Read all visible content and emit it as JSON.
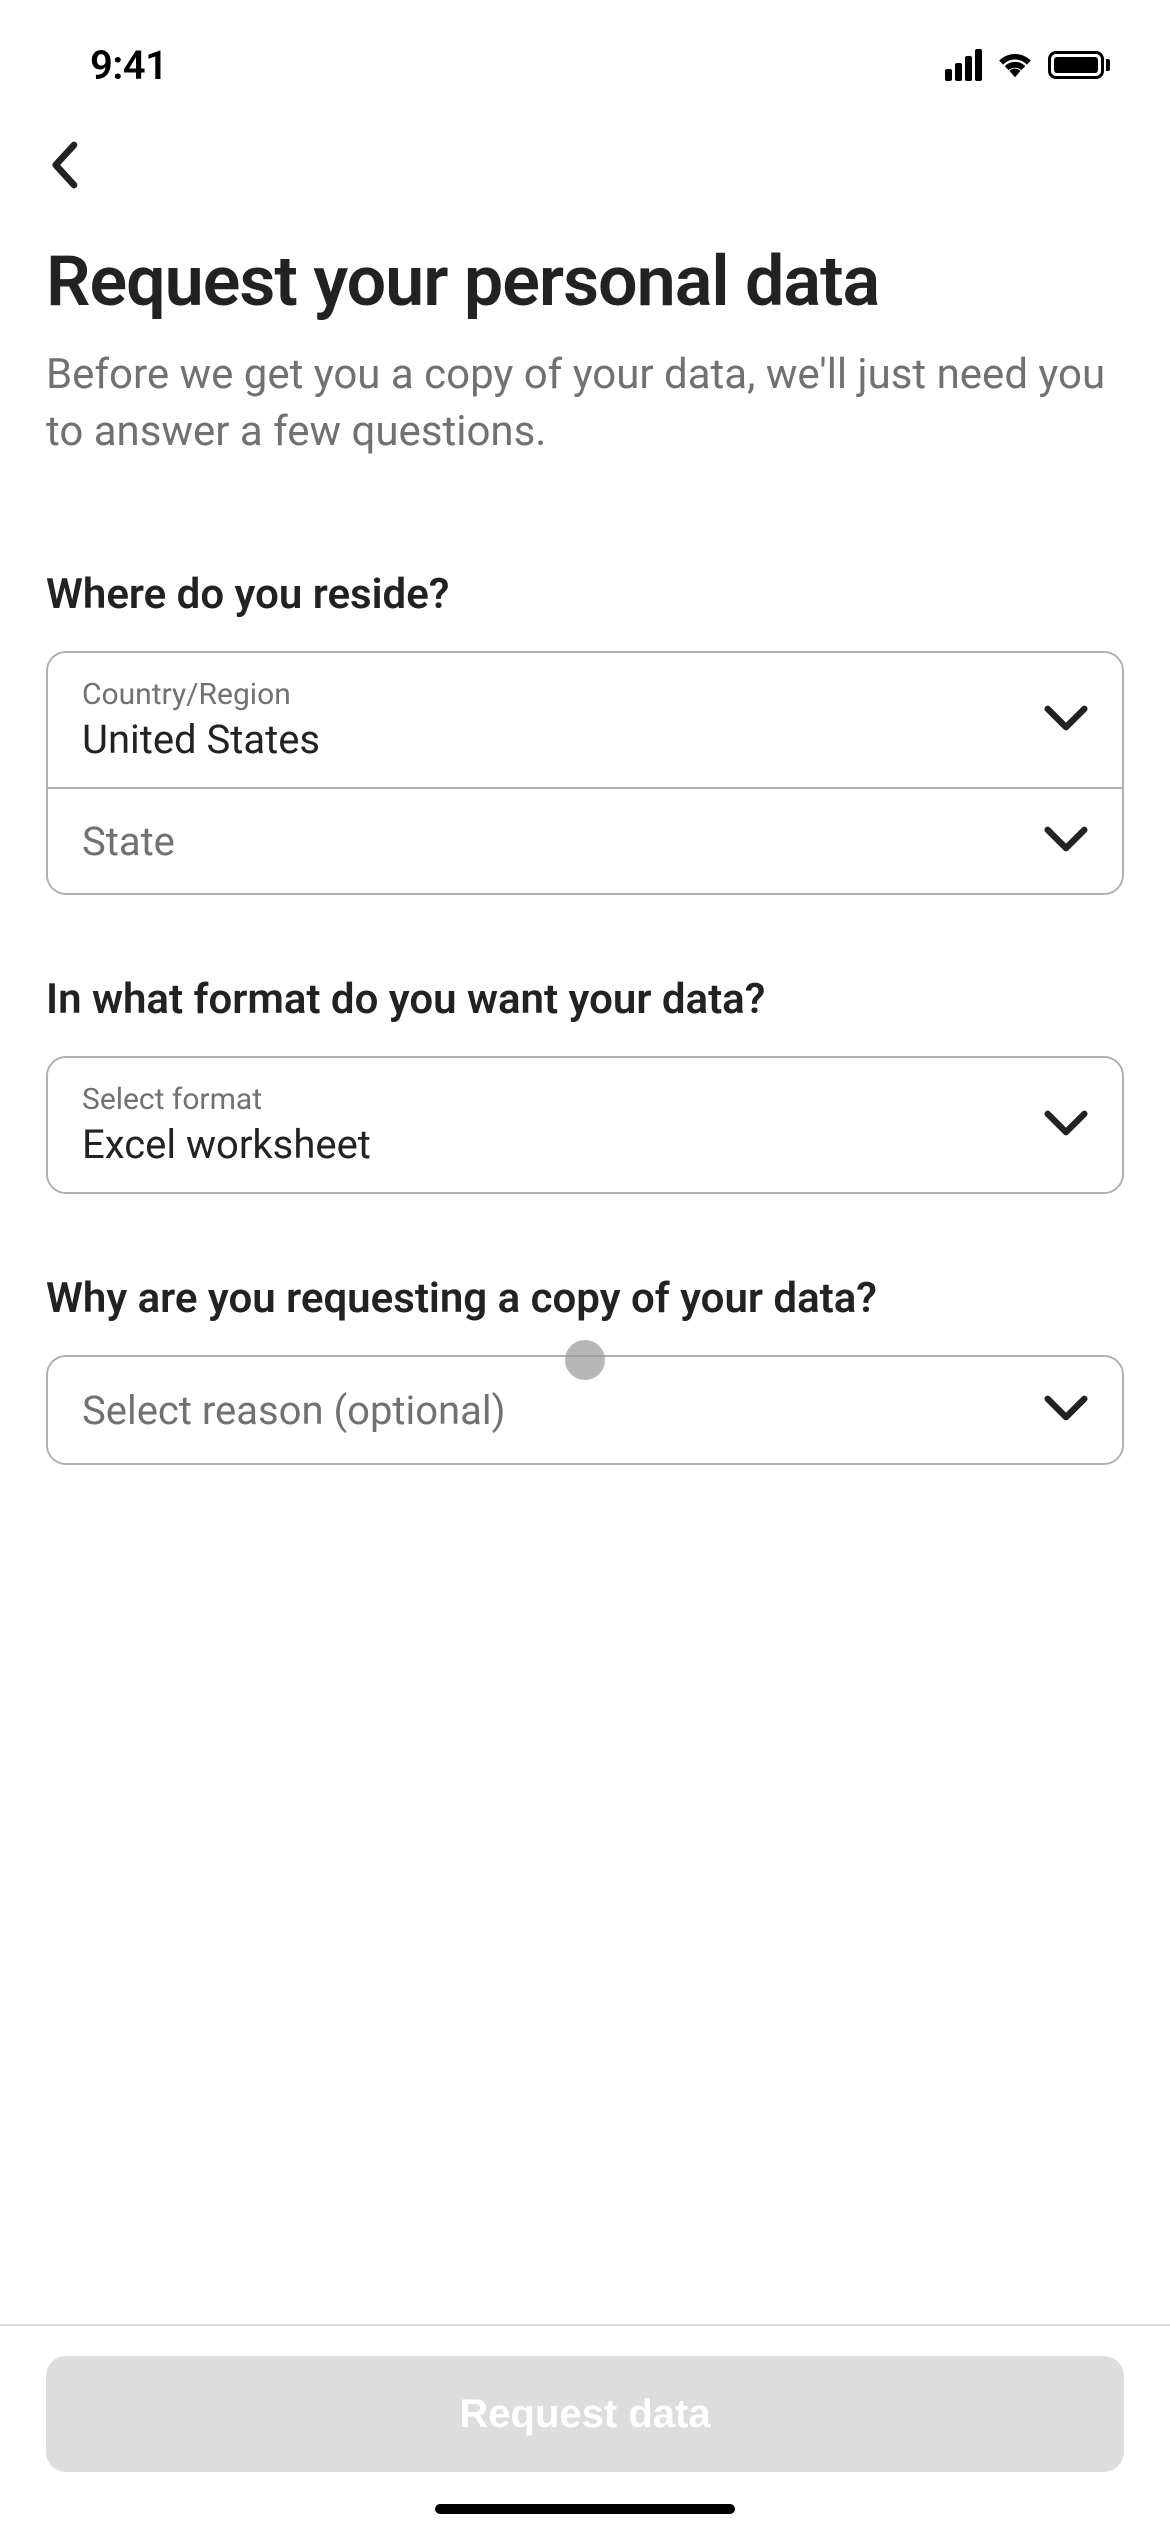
{
  "status_bar": {
    "time": "9:41"
  },
  "header": {
    "title": "Request your personal data",
    "subtitle": "Before we get you a copy of your data, we'll just need you to answer a few questions."
  },
  "sections": {
    "reside": {
      "label": "Where do you reside?",
      "country_label": "Country/Region",
      "country_value": "United States",
      "state_placeholder": "State"
    },
    "format": {
      "label": "In what format do you want your data?",
      "select_label": "Select format",
      "select_value": "Excel worksheet"
    },
    "reason": {
      "label": "Why are you requesting a copy of your data?",
      "placeholder": "Select reason (optional)"
    }
  },
  "footer": {
    "button_label": "Request data"
  }
}
